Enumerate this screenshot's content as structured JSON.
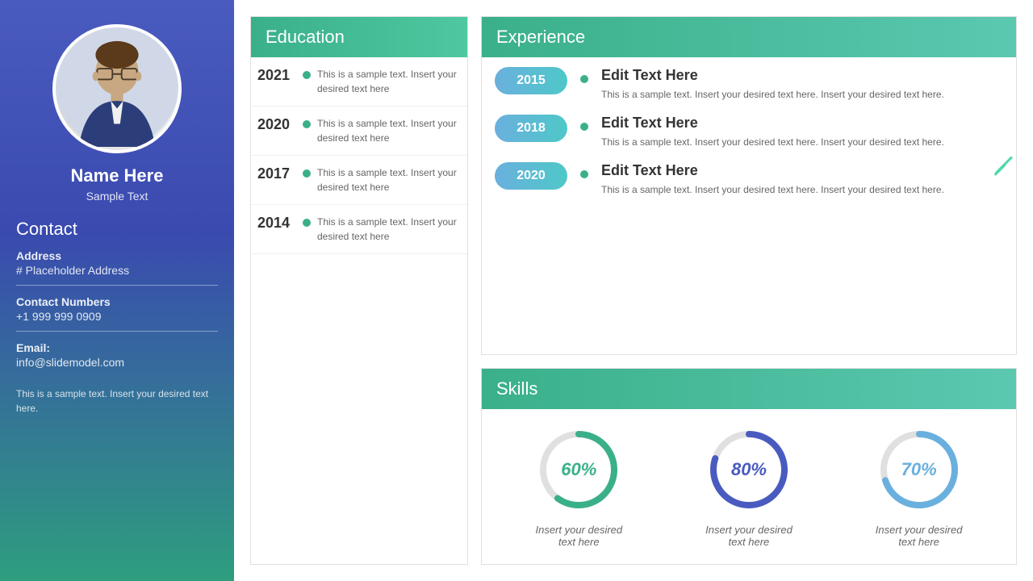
{
  "sidebar": {
    "name": "Name Here",
    "title": "Sample Text",
    "contact_heading": "Contact",
    "address_label": "Address",
    "address_value": "# Placeholder Address",
    "phone_label": "Contact Numbers",
    "phone_value": "+1 999 999 0909",
    "email_label": "Email:",
    "email_value": "info@slidemodel.com",
    "footer_text": "This is a sample text. Insert your desired text here."
  },
  "education": {
    "heading": "Education",
    "items": [
      {
        "year": "2021",
        "text": "This is a sample text. Insert your desired text here"
      },
      {
        "year": "2020",
        "text": "This is a sample text. Insert your desired text here"
      },
      {
        "year": "2017",
        "text": "This is a sample text. Insert your desired text here"
      },
      {
        "year": "2014",
        "text": "This is a sample text. Insert your desired text here"
      }
    ]
  },
  "experience": {
    "heading": "Experience",
    "items": [
      {
        "year": "2015",
        "title": "Edit Text Here",
        "desc": "This is a sample text. Insert your desired text here. Insert your desired text here."
      },
      {
        "year": "2018",
        "title": "Edit Text Here",
        "desc": "This is a sample text. Insert your desired text here. Insert your desired text here."
      },
      {
        "year": "2020",
        "title": "Edit Text Here",
        "desc": "This is a sample text. Insert your desired text here. Insert your desired text here."
      }
    ]
  },
  "skills": {
    "heading": "Skills",
    "items": [
      {
        "percent": 60,
        "label": "Insert your desired\ntext here",
        "color": "#3ab08a",
        "track": "#e0e0e0"
      },
      {
        "percent": 80,
        "label": "Insert your desired\ntext here",
        "color": "#4a5bbf",
        "track": "#e0e0e0"
      },
      {
        "percent": 70,
        "label": "Insert your desired\ntext here",
        "color": "#6ab0de",
        "track": "#e0e0e0"
      }
    ]
  }
}
